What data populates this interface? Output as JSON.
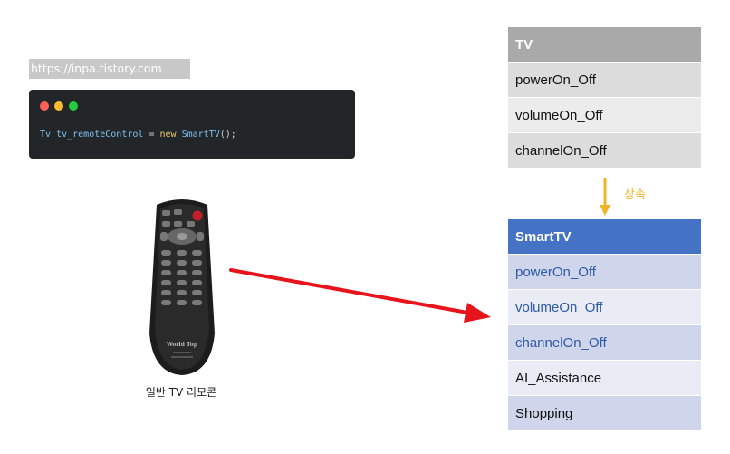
{
  "watermark": "https://inpa.tistory.com",
  "code": {
    "type_name": "Tv",
    "variable": "tv_remoteControl",
    "assign": "=",
    "keyword": "new",
    "class_call": "SmartTV",
    "tail": "();"
  },
  "remote": {
    "caption": "일반 TV 리모콘",
    "brand_text": "World Top"
  },
  "tv_class": {
    "header": "TV",
    "members": [
      "powerOn_Off",
      "volumeOn_Off",
      "channelOn_Off"
    ]
  },
  "inherit_label": "상속",
  "smarttv_class": {
    "header": "SmartTV",
    "inherited_members": [
      "powerOn_Off",
      "volumeOn_Off",
      "channelOn_Off"
    ],
    "own_members": [
      "AI_Assistance",
      "Shopping"
    ]
  },
  "colors": {
    "tv_header": "#a9a9a9",
    "smarttv_header": "#4472c4",
    "inherited_text": "#2f5aa8",
    "arrow": "#e8141c",
    "inherit_arrow": "#f0b429",
    "code_bg": "#232629"
  }
}
